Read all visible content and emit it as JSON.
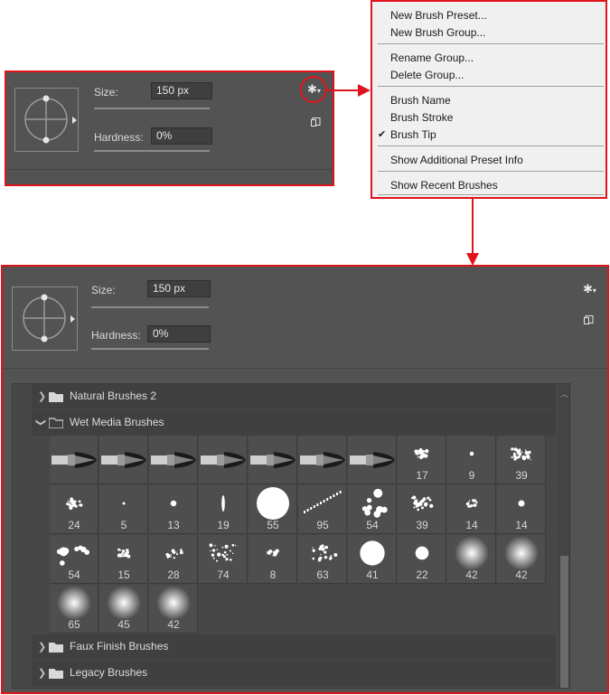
{
  "controls": {
    "size_label": "Size:",
    "size_value": "150 px",
    "hardness_label": "Hardness:",
    "hardness_value": "0%",
    "size_fraction": 0.6,
    "hardness_fraction": 0.0
  },
  "menu": {
    "items": [
      {
        "label": "New Brush Preset..."
      },
      {
        "label": "New Brush Group..."
      },
      {
        "label": "Rename Group..."
      },
      {
        "label": "Delete Group..."
      },
      {
        "label": "Brush Name"
      },
      {
        "label": "Brush Stroke"
      },
      {
        "label": "Brush Tip",
        "checked": true
      },
      {
        "label": "Show Additional Preset Info"
      },
      {
        "label": "Show Recent Brushes"
      }
    ]
  },
  "groups": [
    {
      "name": "Natural Brushes 2",
      "expanded": false
    },
    {
      "name": "Wet Media Brushes",
      "expanded": true
    },
    {
      "name": "Faux Finish Brushes",
      "expanded": false
    },
    {
      "name": "Legacy Brushes",
      "expanded": false
    }
  ],
  "brushes": [
    {
      "kind": "stroke",
      "label": ""
    },
    {
      "kind": "stroke",
      "label": ""
    },
    {
      "kind": "stroke",
      "label": ""
    },
    {
      "kind": "stroke",
      "label": ""
    },
    {
      "kind": "stroke",
      "label": ""
    },
    {
      "kind": "stroke",
      "label": ""
    },
    {
      "kind": "stroke",
      "label": ""
    },
    {
      "kind": "splatter",
      "label": "17"
    },
    {
      "kind": "dot",
      "label": "9"
    },
    {
      "kind": "splatter",
      "label": "39"
    },
    {
      "kind": "splatter",
      "label": "24"
    },
    {
      "kind": "dot",
      "label": "5"
    },
    {
      "kind": "dot",
      "label": "13"
    },
    {
      "kind": "dot",
      "label": "19"
    },
    {
      "kind": "round",
      "label": "55"
    },
    {
      "kind": "dots-line",
      "label": "95"
    },
    {
      "kind": "dots",
      "label": "54"
    },
    {
      "kind": "splatter",
      "label": "39"
    },
    {
      "kind": "splatter",
      "label": "14"
    },
    {
      "kind": "dot",
      "label": "14"
    },
    {
      "kind": "dots",
      "label": "54"
    },
    {
      "kind": "splatter",
      "label": "15"
    },
    {
      "kind": "splatter",
      "label": "28"
    },
    {
      "kind": "splatter",
      "label": "74"
    },
    {
      "kind": "splatter",
      "label": "8"
    },
    {
      "kind": "splatter",
      "label": "63"
    },
    {
      "kind": "round",
      "label": "41"
    },
    {
      "kind": "round",
      "label": "22"
    },
    {
      "kind": "soft",
      "label": "42"
    },
    {
      "kind": "soft",
      "label": "42"
    },
    {
      "kind": "soft",
      "label": "65"
    },
    {
      "kind": "soft",
      "label": "45"
    },
    {
      "kind": "soft",
      "label": "42"
    }
  ],
  "colors": {
    "accent": "#e0141c",
    "panel": "#535353"
  },
  "icons": {
    "gear": "gear-icon",
    "new_preset": "new-preset-icon",
    "folder": "folder-icon",
    "chevron": "chevron-icon"
  }
}
